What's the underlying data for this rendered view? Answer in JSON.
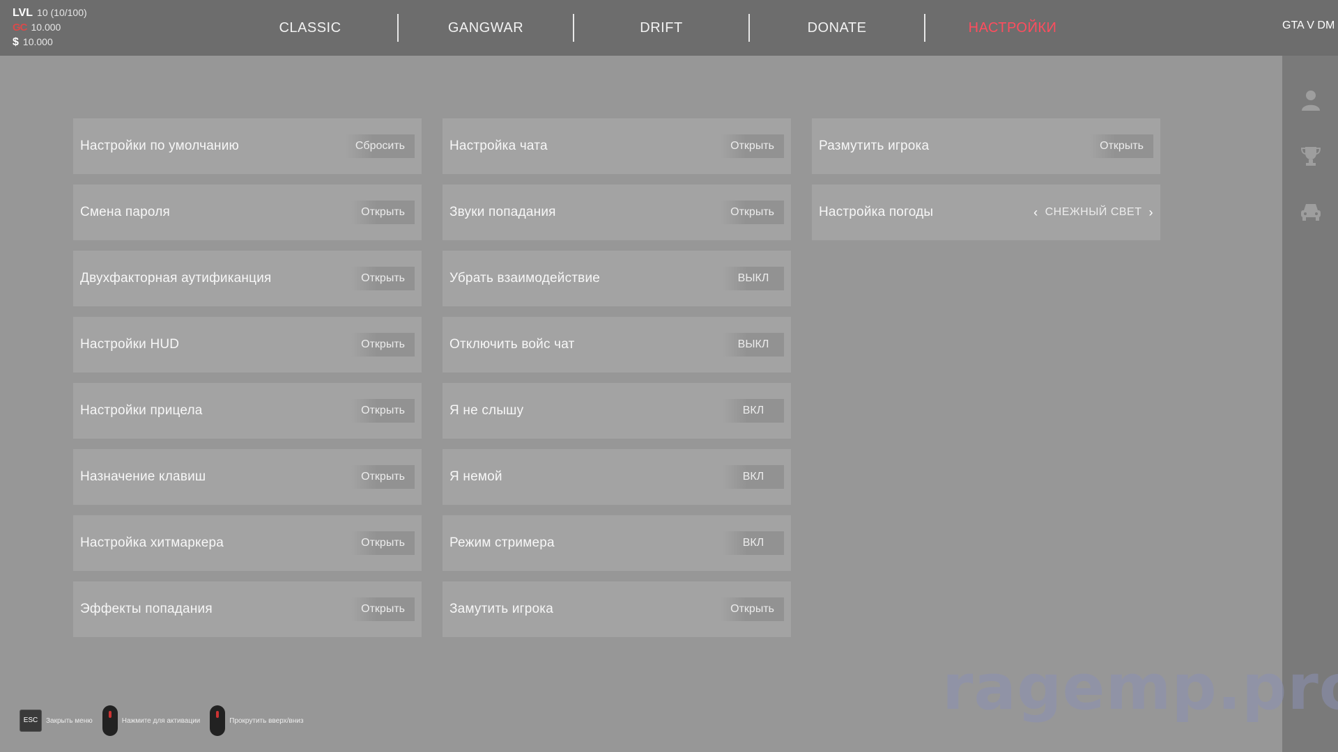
{
  "stats": {
    "lvl_label": "LVL",
    "lvl_value": "10 (10/100)",
    "gc_value": "10.000",
    "money_symbol": "$",
    "money_value": "10.000"
  },
  "nav": {
    "items": [
      "CLASSIC",
      "GANGWAR",
      "DRIFT",
      "DONATE",
      "НАСТРОЙКИ"
    ],
    "active_index": 4,
    "active_color": "#ff4d5e"
  },
  "brand": "GTA V DM",
  "sidebar": {
    "icons": [
      "user-icon",
      "trophy-icon",
      "car-icon"
    ]
  },
  "columns": [
    [
      {
        "label": "Настройки по умолчанию",
        "action": "Сбросить"
      },
      {
        "label": "Смена пароля",
        "action": "Открыть"
      },
      {
        "label": "Двухфакторная аутификанция",
        "action": "Открыть"
      },
      {
        "label": "Настройки HUD",
        "action": "Открыть"
      },
      {
        "label": "Настройки прицела",
        "action": "Открыть"
      },
      {
        "label": "Назначение клавиш",
        "action": "Открыть"
      },
      {
        "label": "Настройка хитмаркера",
        "action": "Открыть"
      },
      {
        "label": "Эффекты попадания",
        "action": "Открыть"
      }
    ],
    [
      {
        "label": "Настройка чата",
        "action": "Открыть"
      },
      {
        "label": "Звуки попадания",
        "action": "Открыть"
      },
      {
        "label": "Убрать взаимодействие",
        "action": "ВЫКЛ"
      },
      {
        "label": "Отключить войс чат",
        "action": "ВЫКЛ"
      },
      {
        "label": "Я не слышу",
        "action": "ВКЛ"
      },
      {
        "label": "Я немой",
        "action": "ВКЛ"
      },
      {
        "label": "Режим стримера",
        "action": "ВКЛ"
      },
      {
        "label": "Замутить игрока",
        "action": "Открыть"
      }
    ],
    [
      {
        "label": "Размутить игрока",
        "action": "Открыть"
      }
    ]
  ],
  "weather": {
    "label": "Настройка погоды",
    "value": "СНЕЖНЫЙ СВЕТ"
  },
  "hints": {
    "esc_key": "ESC",
    "esc_text": "Закрыть меню",
    "click_text": "Нажмите для активации",
    "scroll_text": "Прокрутить вверх/вниз"
  },
  "watermark": "ragemp.pro"
}
